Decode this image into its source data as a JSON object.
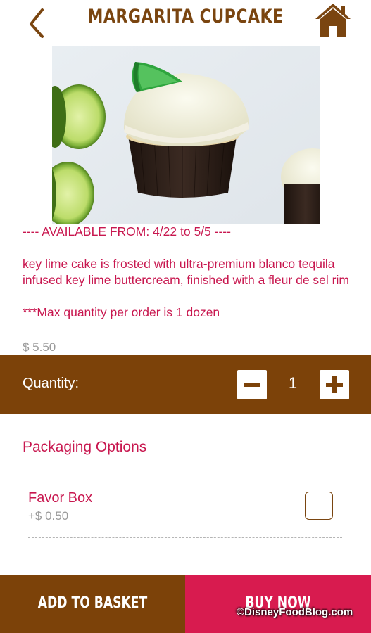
{
  "header": {
    "title": "MARGARITA CUPCAKE",
    "back_icon": "chevron-left-icon",
    "home_icon": "home-icon",
    "brand_color": "#7a4510"
  },
  "product": {
    "availability": "---- AVAILABLE FROM: 4/22 to 5/5 ----",
    "description": "key lime cake is frosted with ultra-premium blanco tequila infused key lime buttercream, finished with a fleur de sel rim",
    "max_note": "***Max quantity per order is 1 dozen",
    "price": "$ 5.50",
    "accent_color": "#c8174f"
  },
  "quantity": {
    "label": "Quantity:",
    "value": "1",
    "minus_icon": "minus-icon",
    "plus_icon": "plus-icon"
  },
  "packaging": {
    "title": "Packaging Options",
    "options": [
      {
        "name": "Favor Box",
        "price": "+$ 0.50",
        "checked": false
      }
    ]
  },
  "actions": {
    "add_to_basket": "ADD TO BASKET",
    "buy_now": "BUY NOW",
    "basket_color": "#7c4209",
    "buy_color": "#d81b4f"
  },
  "watermark": "©DisneyFoodBlog.com"
}
